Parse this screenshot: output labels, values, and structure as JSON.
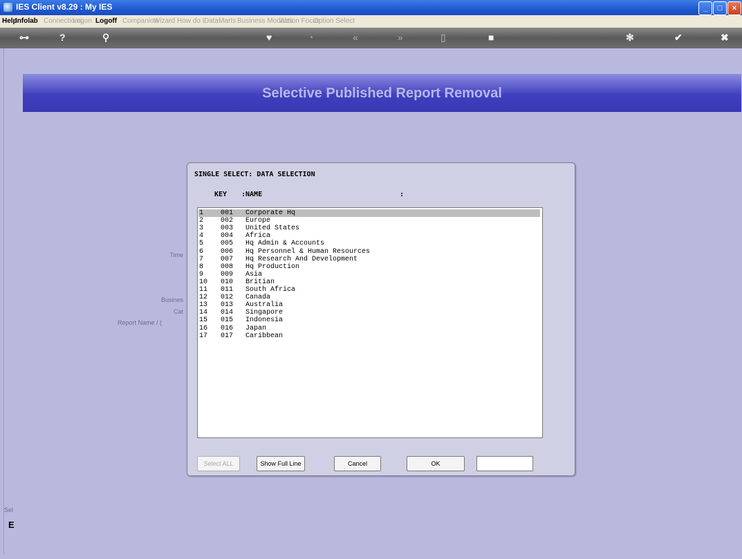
{
  "window": {
    "title": "IES Client v8.29 : My IES"
  },
  "menu": {
    "items": [
      {
        "label": "Help",
        "style": "active"
      },
      {
        "label": "Infolab",
        "style": "active"
      },
      {
        "label": "Connections",
        "style": "dim"
      },
      {
        "label": "Logon",
        "style": "dim"
      },
      {
        "label": "Logoff",
        "style": "active"
      },
      {
        "label": "Companion",
        "style": "dim"
      },
      {
        "label": "Wizard",
        "style": "dim"
      },
      {
        "label": "How do I",
        "style": "dim"
      },
      {
        "label": "DataMarts",
        "style": "dim"
      },
      {
        "label": "Business Modules",
        "style": "dim"
      },
      {
        "label": "Action Focus",
        "style": "dim"
      },
      {
        "label": "Option Select",
        "style": "dim"
      }
    ]
  },
  "page": {
    "title": "Selective Published Report Removal"
  },
  "sidelabels": {
    "time": "Time",
    "business": "Busines",
    "cat": "Cat",
    "report": "Report Name / ("
  },
  "bottom": {
    "label1": "Sel",
    "label2": "E"
  },
  "dialog": {
    "title": "SINGLE SELECT: DATA SELECTION",
    "col_key": "KEY",
    "col_name": ":NAME",
    "col_end": ":",
    "rows": [
      {
        "n": "1",
        "key": "001",
        "name": "Corporate Hq"
      },
      {
        "n": "2",
        "key": "002",
        "name": "Europe"
      },
      {
        "n": "3",
        "key": "003",
        "name": "United States"
      },
      {
        "n": "4",
        "key": "004",
        "name": "Africa"
      },
      {
        "n": "5",
        "key": "005",
        "name": "Hq Admin & Accounts"
      },
      {
        "n": "6",
        "key": "006",
        "name": "Hq Personnel & Human Resources"
      },
      {
        "n": "7",
        "key": "007",
        "name": "Hq Research And Development"
      },
      {
        "n": "8",
        "key": "008",
        "name": "Hq Production"
      },
      {
        "n": "9",
        "key": "009",
        "name": "Asia"
      },
      {
        "n": "10",
        "key": "010",
        "name": "Britian"
      },
      {
        "n": "11",
        "key": "011",
        "name": "South Africa"
      },
      {
        "n": "12",
        "key": "012",
        "name": "Canada"
      },
      {
        "n": "13",
        "key": "013",
        "name": "Australia"
      },
      {
        "n": "14",
        "key": "014",
        "name": "Singapore"
      },
      {
        "n": "15",
        "key": "015",
        "name": "Indonesia"
      },
      {
        "n": "16",
        "key": "016",
        "name": "Japan"
      },
      {
        "n": "17",
        "key": "017",
        "name": "Caribbean"
      }
    ],
    "selected_row": "1",
    "buttons": {
      "select_all": "Select ALL",
      "show_full": "Show Full Line",
      "cancel": "Cancel",
      "ok": "OK"
    },
    "search_value": ""
  }
}
